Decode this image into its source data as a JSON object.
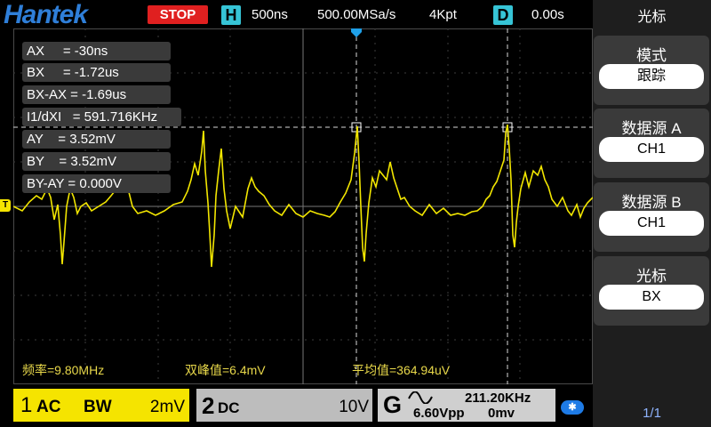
{
  "header": {
    "brand": "Hantek",
    "status": "STOP",
    "timebase_tag": "H",
    "timebase": "500ns",
    "sample_rate": "500.00MSa/s",
    "memory_depth": "4Kpt",
    "delay_tag": "D",
    "delay": "0.00s"
  },
  "cursor_readouts": [
    "AX     = -30ns",
    "BX     = -1.72us",
    "BX-AX = -1.69us",
    "I1/dXI   = 591.716KHz",
    "AY    = 3.52mV",
    "BY    = 3.52mV",
    "BY-AY = 0.000V"
  ],
  "measurements": {
    "frequency": "频率=9.80MHz",
    "peak_to_peak": "双峰值=6.4mV",
    "mean": "平均值=364.94uV"
  },
  "trigger_level_marker": "T",
  "channels": {
    "ch1": {
      "number": "1",
      "coupling": "AC",
      "bw": "BW",
      "scale": "2mV"
    },
    "ch2": {
      "number": "2",
      "coupling": "DC",
      "scale": "10V"
    },
    "generator": {
      "label": "G",
      "frequency": "211.20KHz",
      "amplitude": "6.60Vpp",
      "offset": "0mv"
    }
  },
  "side_menu": {
    "title": "光标",
    "items": [
      {
        "label": "模式",
        "value": "跟踪"
      },
      {
        "label": "数据源 A",
        "value": "CH1"
      },
      {
        "label": "数据源 B",
        "value": "CH1"
      },
      {
        "label": "光标",
        "value": "BX"
      }
    ],
    "page": "1/1"
  },
  "colors": {
    "trace": "#f2e600",
    "ch1": "#f5e400",
    "accent": "#36c4d6",
    "stop": "#e02020"
  }
}
